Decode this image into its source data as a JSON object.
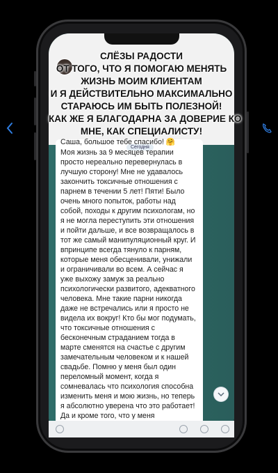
{
  "overlay": {
    "lines": [
      "СЛЁЗЫ РАДОСТИ",
      "ОТ ТОГО, ЧТО Я ПОМОГАЮ МЕНЯТЬ",
      "ЖИЗНЬ МОИМ КЛИЕНТАМ",
      "И Я ДЕЙСТВИТЕЛЬНО МАКСИМАЛЬНО",
      "СТАРАЮСЬ ИМ БЫТЬ ПОЛЕЗНОЙ!",
      "КАК ЖЕ Я БЛАГОДАРНА ЗА ДОВЕРИЕ КО",
      "МНЕ, КАК СПЕЦИАЛИСТУ!"
    ]
  },
  "chat": {
    "date_label": "Сегодня",
    "first_line": "Саша, большое тебе спасибо! 🤗",
    "message": "Моя жизнь за 9 месяцев терапии просто нереально перевернулась в лучшую сторону! Мне не удавалось закончить токсичные отношения с парнем в течении 5 лет! Пяти! Было очень много попыток, работы над собой, походы к другим психологам, но я не могла переступить эти отношения и пойти дальше, и все возвращалось в тот же самый манипуляционный круг. И впринципе всегда тянуло к парням, которые меня обесценивали, унижали и ограничивали во всем. А сейчас я уже выхожу замуж за реально психологически развитого, адекватного человека. Мне такие парни никогда даже не встречались или я просто не видела их вокруг! Кто бы мог подумать, что токсичные отношения с бесконечным страданием тогда в марте сменятся на счастье с другим замечательным человеком и к нашей свадьбе. Помню у меня был один переломный момент, когда я сомневалась что психология способна изменить меня и мою жизнь, но теперь я абсолютно уверена что это работает! Да и кроме того, что у меня наладилась личная жизнь, ты помогла мне стать"
  },
  "colors": {
    "wallpaper": "#2e6a66",
    "bubble": "#ffffff",
    "header": "#f2f2f2"
  }
}
